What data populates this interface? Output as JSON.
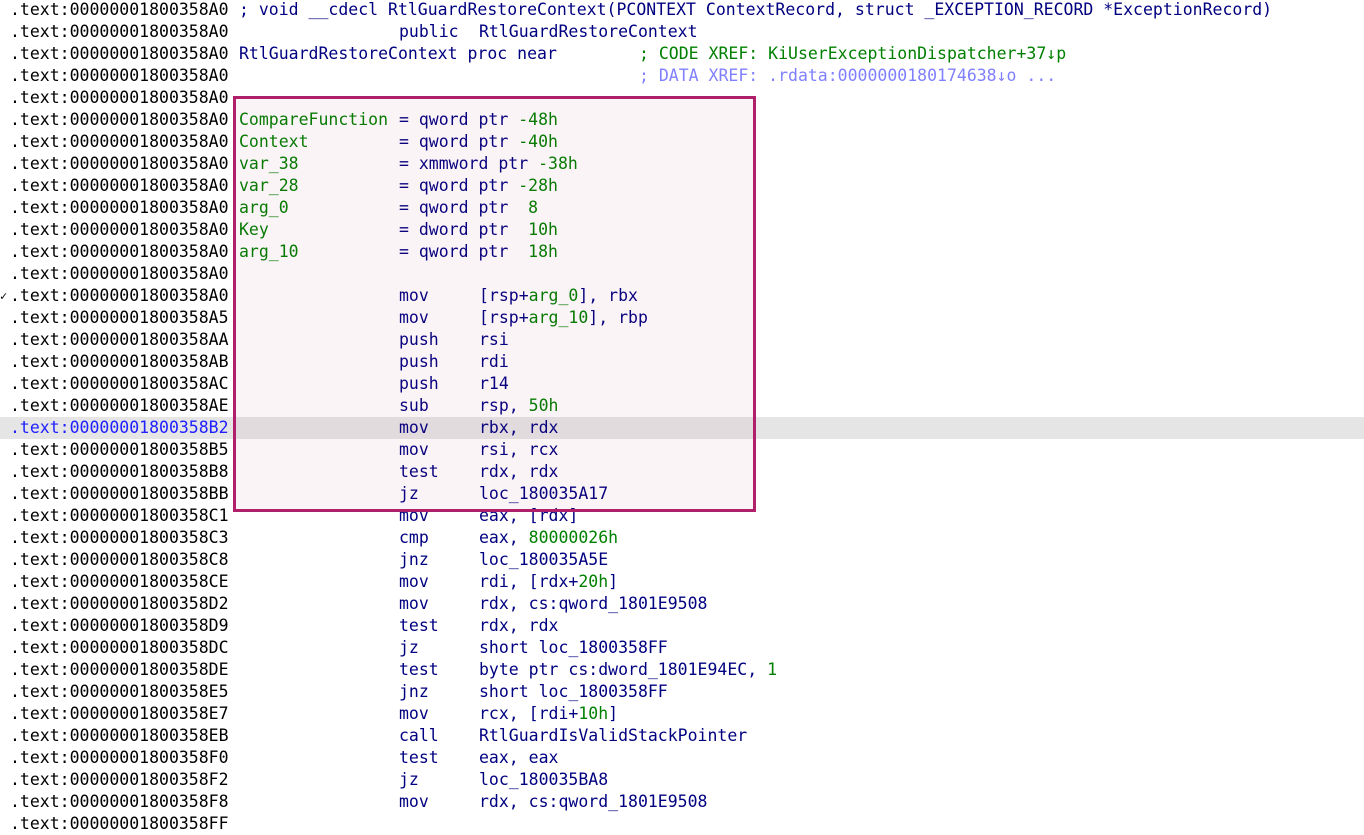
{
  "colors": {
    "address": "#000000",
    "current_address": "#2020ff",
    "instruction": "#000080",
    "variable_name": "#008000",
    "comment": "#008000",
    "xref_gray": "#8080ff",
    "current_line_bg": "#e5e5e5",
    "highlight_border": "#b0206a"
  },
  "lines": [
    {
      "address": ".text:00000001800358A0",
      "full": [
        {
          "t": "; void __cdecl RtlGuardRestoreContext(PCONTEXT ContextRecord, struct _EXCEPTION_RECORD *ExceptionRecord)",
          "c": "navy"
        }
      ]
    },
    {
      "address": ".text:00000001800358A0",
      "mnemonic": "public",
      "operand": [
        {
          "t": "RtlGuardRestoreContext",
          "c": "navy"
        }
      ]
    },
    {
      "address": ".text:00000001800358A0",
      "label": [
        {
          "t": "RtlGuardRestoreContext proc near",
          "c": "navy"
        }
      ],
      "xref": [
        {
          "t": "; CODE XREF: KiUserExceptionDispatcher+37↓p",
          "c": "green"
        }
      ]
    },
    {
      "address": ".text:00000001800358A0",
      "xref": [
        {
          "t": "; DATA XREF: .rdata:0000000180174638↓o ...",
          "c": "xrefgray"
        }
      ]
    },
    {
      "address": ".text:00000001800358A0"
    },
    {
      "address": ".text:00000001800358A0",
      "label": [
        {
          "t": "CompareFunction",
          "c": "green"
        }
      ],
      "eq": [
        {
          "t": "= qword ptr ",
          "c": "navy"
        },
        {
          "t": "-48h",
          "c": "green"
        }
      ]
    },
    {
      "address": ".text:00000001800358A0",
      "label": [
        {
          "t": "Context",
          "c": "green"
        }
      ],
      "eq": [
        {
          "t": "= qword ptr ",
          "c": "navy"
        },
        {
          "t": "-40h",
          "c": "green"
        }
      ]
    },
    {
      "address": ".text:00000001800358A0",
      "label": [
        {
          "t": "var_38",
          "c": "green"
        }
      ],
      "eq": [
        {
          "t": "= xmmword ptr ",
          "c": "navy"
        },
        {
          "t": "-38h",
          "c": "green"
        }
      ]
    },
    {
      "address": ".text:00000001800358A0",
      "label": [
        {
          "t": "var_28",
          "c": "green"
        }
      ],
      "eq": [
        {
          "t": "= qword ptr ",
          "c": "navy"
        },
        {
          "t": "-28h",
          "c": "green"
        }
      ]
    },
    {
      "address": ".text:00000001800358A0",
      "label": [
        {
          "t": "arg_0",
          "c": "green"
        }
      ],
      "eq": [
        {
          "t": "= qword ptr  ",
          "c": "navy"
        },
        {
          "t": "8",
          "c": "green"
        }
      ]
    },
    {
      "address": ".text:00000001800358A0",
      "label": [
        {
          "t": "Key",
          "c": "green"
        }
      ],
      "eq": [
        {
          "t": "= dword ptr  ",
          "c": "navy"
        },
        {
          "t": "10h",
          "c": "green"
        }
      ]
    },
    {
      "address": ".text:00000001800358A0",
      "label": [
        {
          "t": "arg_10",
          "c": "green"
        }
      ],
      "eq": [
        {
          "t": "= qword ptr  ",
          "c": "navy"
        },
        {
          "t": "18h",
          "c": "green"
        }
      ]
    },
    {
      "address": ".text:00000001800358A0"
    },
    {
      "address": ".text:00000001800358A0",
      "marker": "✓",
      "mnemonic": "mov",
      "operand": [
        {
          "t": "[rsp+",
          "c": "navy"
        },
        {
          "t": "arg_0",
          "c": "green"
        },
        {
          "t": "], rbx",
          "c": "navy"
        }
      ]
    },
    {
      "address": ".text:00000001800358A5",
      "mnemonic": "mov",
      "operand": [
        {
          "t": "[rsp+",
          "c": "navy"
        },
        {
          "t": "arg_10",
          "c": "green"
        },
        {
          "t": "], rbp",
          "c": "navy"
        }
      ]
    },
    {
      "address": ".text:00000001800358AA",
      "mnemonic": "push",
      "operand": [
        {
          "t": "rsi",
          "c": "navy"
        }
      ]
    },
    {
      "address": ".text:00000001800358AB",
      "mnemonic": "push",
      "operand": [
        {
          "t": "rdi",
          "c": "navy"
        }
      ]
    },
    {
      "address": ".text:00000001800358AC",
      "mnemonic": "push",
      "operand": [
        {
          "t": "r14",
          "c": "navy"
        }
      ]
    },
    {
      "address": ".text:00000001800358AE",
      "mnemonic": "sub",
      "operand": [
        {
          "t": "rsp, ",
          "c": "navy"
        },
        {
          "t": "50h",
          "c": "green"
        }
      ]
    },
    {
      "address": ".text:00000001800358B2",
      "current": true,
      "mnemonic": "mov",
      "operand": [
        {
          "t": "rbx, rdx",
          "c": "navy"
        }
      ]
    },
    {
      "address": ".text:00000001800358B5",
      "mnemonic": "mov",
      "operand": [
        {
          "t": "rsi, rcx",
          "c": "navy"
        }
      ]
    },
    {
      "address": ".text:00000001800358B8",
      "mnemonic": "test",
      "operand": [
        {
          "t": "rdx, rdx",
          "c": "navy"
        }
      ]
    },
    {
      "address": ".text:00000001800358BB",
      "mnemonic": "jz",
      "operand": [
        {
          "t": "loc_180035A17",
          "c": "navy"
        }
      ]
    },
    {
      "address": ".text:00000001800358C1",
      "mnemonic": "mov",
      "operand": [
        {
          "t": "eax, [rdx]",
          "c": "navy"
        }
      ]
    },
    {
      "address": ".text:00000001800358C3",
      "mnemonic": "cmp",
      "operand": [
        {
          "t": "eax, ",
          "c": "navy"
        },
        {
          "t": "80000026h",
          "c": "green"
        }
      ]
    },
    {
      "address": ".text:00000001800358C8",
      "mnemonic": "jnz",
      "operand": [
        {
          "t": "loc_180035A5E",
          "c": "navy"
        }
      ]
    },
    {
      "address": ".text:00000001800358CE",
      "mnemonic": "mov",
      "operand": [
        {
          "t": "rdi, [rdx+",
          "c": "navy"
        },
        {
          "t": "20h",
          "c": "green"
        },
        {
          "t": "]",
          "c": "navy"
        }
      ]
    },
    {
      "address": ".text:00000001800358D2",
      "mnemonic": "mov",
      "operand": [
        {
          "t": "rdx, cs:qword_1801E9508",
          "c": "navy"
        }
      ]
    },
    {
      "address": ".text:00000001800358D9",
      "mnemonic": "test",
      "operand": [
        {
          "t": "rdx, rdx",
          "c": "navy"
        }
      ]
    },
    {
      "address": ".text:00000001800358DC",
      "mnemonic": "jz",
      "operand": [
        {
          "t": "short loc_1800358FF",
          "c": "navy"
        }
      ]
    },
    {
      "address": ".text:00000001800358DE",
      "mnemonic": "test",
      "operand": [
        {
          "t": "byte ptr cs:dword_1801E94EC, ",
          "c": "navy"
        },
        {
          "t": "1",
          "c": "green"
        }
      ]
    },
    {
      "address": ".text:00000001800358E5",
      "mnemonic": "jnz",
      "operand": [
        {
          "t": "short loc_1800358FF",
          "c": "navy"
        }
      ]
    },
    {
      "address": ".text:00000001800358E7",
      "mnemonic": "mov",
      "operand": [
        {
          "t": "rcx, [rdi+",
          "c": "navy"
        },
        {
          "t": "10h",
          "c": "green"
        },
        {
          "t": "]",
          "c": "navy"
        }
      ]
    },
    {
      "address": ".text:00000001800358EB",
      "mnemonic": "call",
      "operand": [
        {
          "t": "RtlGuardIsValidStackPointer",
          "c": "navy"
        }
      ]
    },
    {
      "address": ".text:00000001800358F0",
      "mnemonic": "test",
      "operand": [
        {
          "t": "eax, eax",
          "c": "navy"
        }
      ]
    },
    {
      "address": ".text:00000001800358F2",
      "mnemonic": "jz",
      "operand": [
        {
          "t": "loc_180035BA8",
          "c": "navy"
        }
      ]
    },
    {
      "address": ".text:00000001800358F8",
      "mnemonic": "mov",
      "operand": [
        {
          "t": "rdx, cs:qword_1801E9508",
          "c": "navy"
        }
      ]
    },
    {
      "address": ".text:00000001800358FF"
    }
  ]
}
